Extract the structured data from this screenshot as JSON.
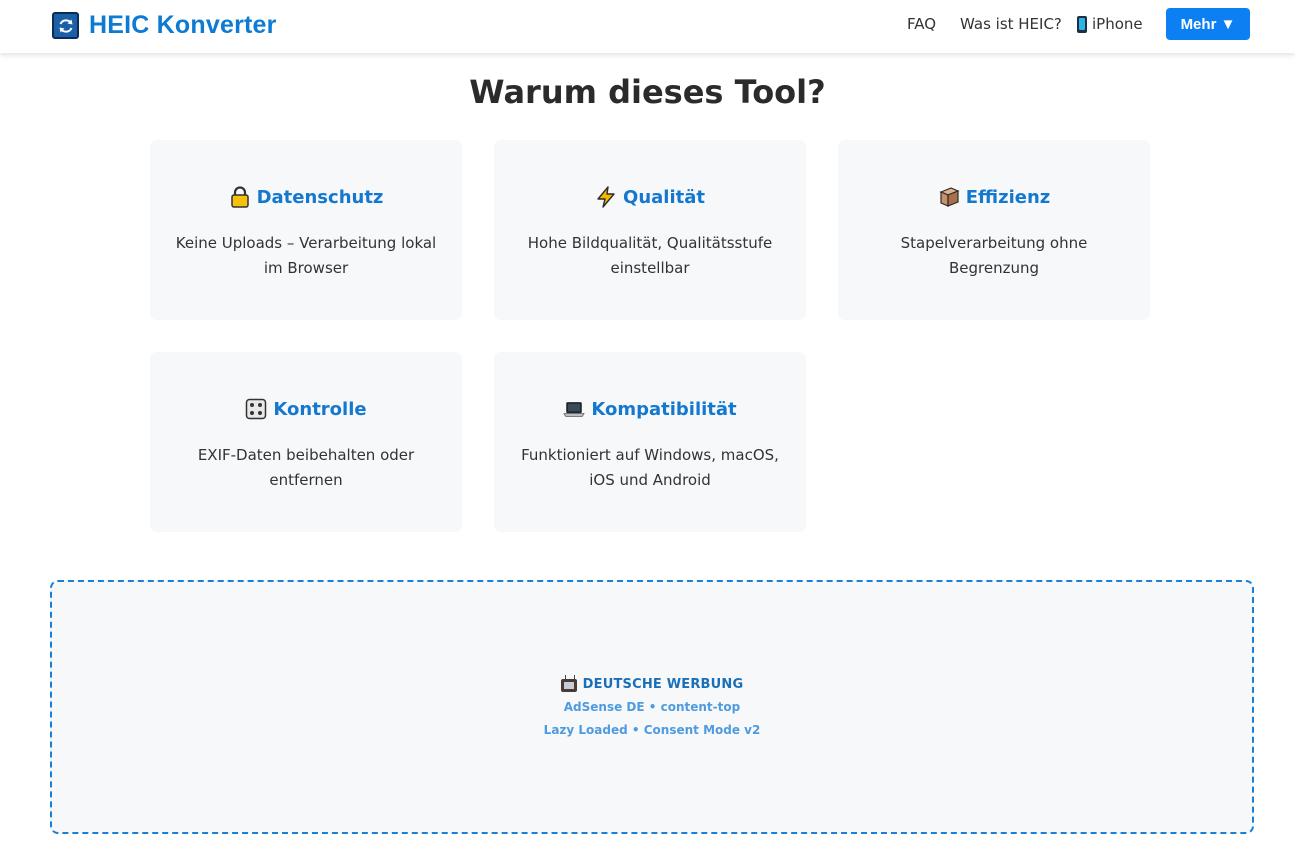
{
  "header": {
    "brand": "HEIC Konverter",
    "nav": {
      "faq": "FAQ",
      "heic": "Was ist HEIC?",
      "iphone": "iPhone",
      "mehr": "Mehr ▼"
    }
  },
  "section": {
    "title": "Warum dieses Tool?"
  },
  "cards": [
    {
      "icon": "lock-icon",
      "title": "Datenschutz",
      "text": "Keine Uploads – Verarbeitung lokal im Browser"
    },
    {
      "icon": "lightning-icon",
      "title": "Qualität",
      "text": "Hohe Bildqualität, Qualitätsstufe einstellbar"
    },
    {
      "icon": "box-icon",
      "title": "Effizienz",
      "text": "Stapelverarbeitung ohne Begrenzung"
    },
    {
      "icon": "control-knobs-icon",
      "title": "Kontrolle",
      "text": "EXIF-Daten beibehalten oder entfernen"
    },
    {
      "icon": "laptop-icon",
      "title": "Kompatibilität",
      "text": "Funktioniert auf Windows, macOS, iOS und Android"
    }
  ],
  "ad": {
    "icon": "tv-icon",
    "title": "DEUTSCHE WERBUNG",
    "line1": "AdSense DE • content-top",
    "line2": "Lazy Loaded • Consent Mode v2"
  },
  "colors": {
    "brand": "#0d7bd4",
    "button": "#0c7ff2",
    "card_title": "#1478cf",
    "card_bg": "#f7f8fa",
    "ad_border": "#1a7fd6"
  }
}
